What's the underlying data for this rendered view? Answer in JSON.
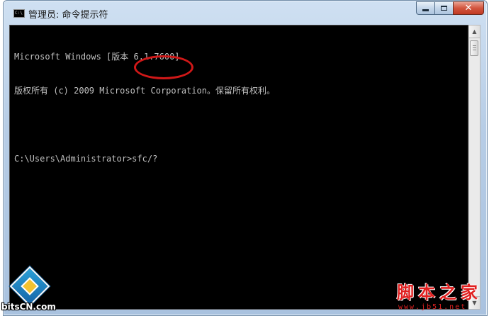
{
  "window": {
    "title": "管理员: 命令提示符",
    "icon": "cmd-icon"
  },
  "caption_buttons": {
    "minimize_icon": "minimize-icon",
    "maximize_icon": "maximize-icon",
    "close_icon": "close-icon",
    "close_glyph": "✕"
  },
  "console": {
    "lines": [
      "Microsoft Windows [版本 6.1.7600]",
      "版权所有 (c) 2009 Microsoft Corporation。保留所有权利。",
      "",
      "C:\\Users\\Administrator>sfc/?"
    ],
    "text_color": "#c0c0c0",
    "background": "#000000",
    "annotation_color": "#d01818"
  },
  "scrollbar": {
    "up_glyph": "▲",
    "down_glyph": "▼"
  },
  "watermarks": {
    "left_text": "bitsCN.com",
    "right_title": "脚本之家",
    "right_url": "www.jb51.net"
  }
}
